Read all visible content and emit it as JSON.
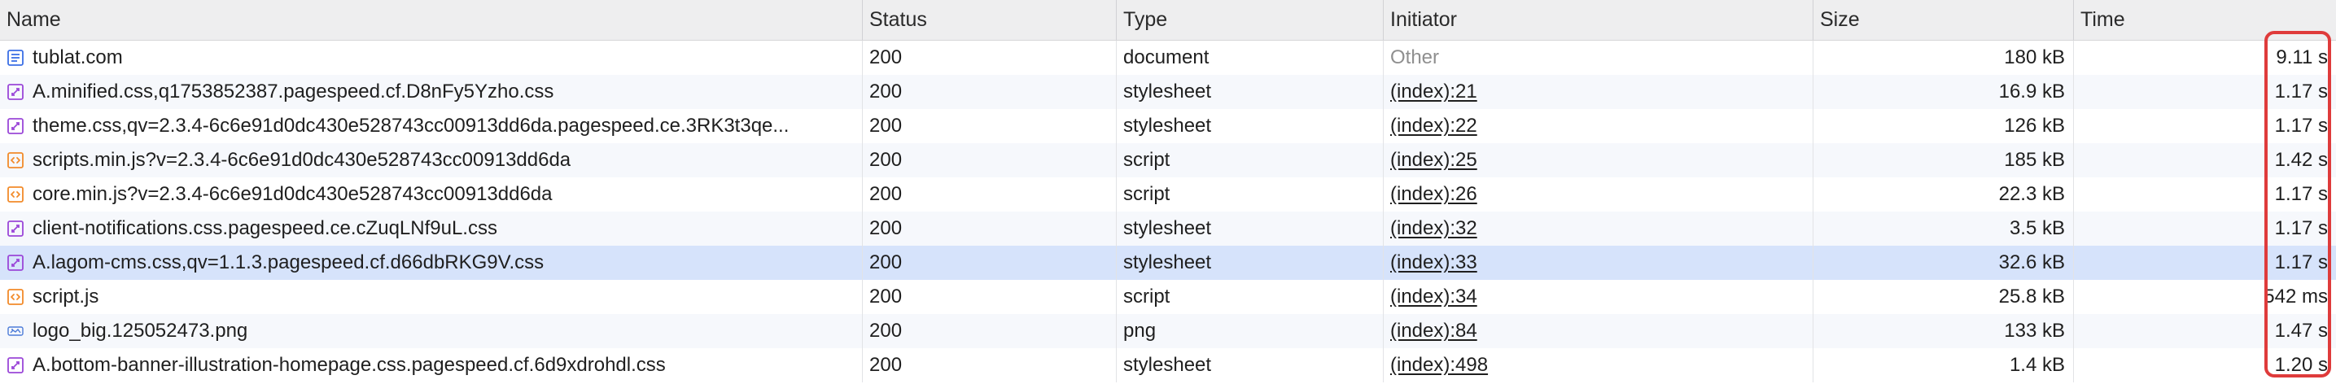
{
  "columns": {
    "name": "Name",
    "status": "Status",
    "type": "Type",
    "initiator": "Initiator",
    "size": "Size",
    "time": "Time"
  },
  "rows": [
    {
      "name": "tublat.com",
      "status": "200",
      "type": "document",
      "initiator": "Other",
      "size": "180 kB",
      "time": "9.11 s",
      "icon": "document-icon"
    },
    {
      "name": "A.minified.css,q1753852387.pagespeed.cf.D8nFy5Yzho.css",
      "status": "200",
      "type": "stylesheet",
      "initiator": "(index):21",
      "size": "16.9 kB",
      "time": "1.17 s",
      "icon": "stylesheet-icon"
    },
    {
      "name": "theme.css,qv=2.3.4-6c6e91d0dc430e528743cc00913dd6da.pagespeed.ce.3RK3t3qe...",
      "status": "200",
      "type": "stylesheet",
      "initiator": "(index):22",
      "size": "126 kB",
      "time": "1.17 s",
      "icon": "stylesheet-icon"
    },
    {
      "name": "scripts.min.js?v=2.3.4-6c6e91d0dc430e528743cc00913dd6da",
      "status": "200",
      "type": "script",
      "initiator": "(index):25",
      "size": "185 kB",
      "time": "1.42 s",
      "icon": "script-icon"
    },
    {
      "name": "core.min.js?v=2.3.4-6c6e91d0dc430e528743cc00913dd6da",
      "status": "200",
      "type": "script",
      "initiator": "(index):26",
      "size": "22.3 kB",
      "time": "1.17 s",
      "icon": "script-icon"
    },
    {
      "name": "client-notifications.css.pagespeed.ce.cZuqLNf9uL.css",
      "status": "200",
      "type": "stylesheet",
      "initiator": "(index):32",
      "size": "3.5 kB",
      "time": "1.17 s",
      "icon": "stylesheet-icon"
    },
    {
      "name": "A.lagom-cms.css,qv=1.1.3.pagespeed.cf.d66dbRKG9V.css",
      "status": "200",
      "type": "stylesheet",
      "initiator": "(index):33",
      "size": "32.6 kB",
      "time": "1.17 s",
      "icon": "stylesheet-icon",
      "selected": true
    },
    {
      "name": "script.js",
      "status": "200",
      "type": "script",
      "initiator": "(index):34",
      "size": "25.8 kB",
      "time": "542 ms",
      "icon": "script-icon"
    },
    {
      "name": "logo_big.125052473.png",
      "status": "200",
      "type": "png",
      "initiator": "(index):84",
      "size": "133 kB",
      "time": "1.47 s",
      "icon": "image-icon"
    },
    {
      "name": "A.bottom-banner-illustration-homepage.css.pagespeed.cf.6d9xdrohdl.css",
      "status": "200",
      "type": "stylesheet",
      "initiator": "(index):498",
      "size": "1.4 kB",
      "time": "1.20 s",
      "icon": "stylesheet-icon"
    }
  ],
  "colors": {
    "header_bg": "#eeeeef",
    "selected_row_bg": "#d6e3fb",
    "alt_row_bg": "#f6f8fc",
    "highlight_border": "#df3b3b",
    "document_icon": "#3b6fe5",
    "stylesheet_icon": "#9b47d8",
    "script_icon": "#f28b2a",
    "image_icon": "#4c7bd8"
  }
}
